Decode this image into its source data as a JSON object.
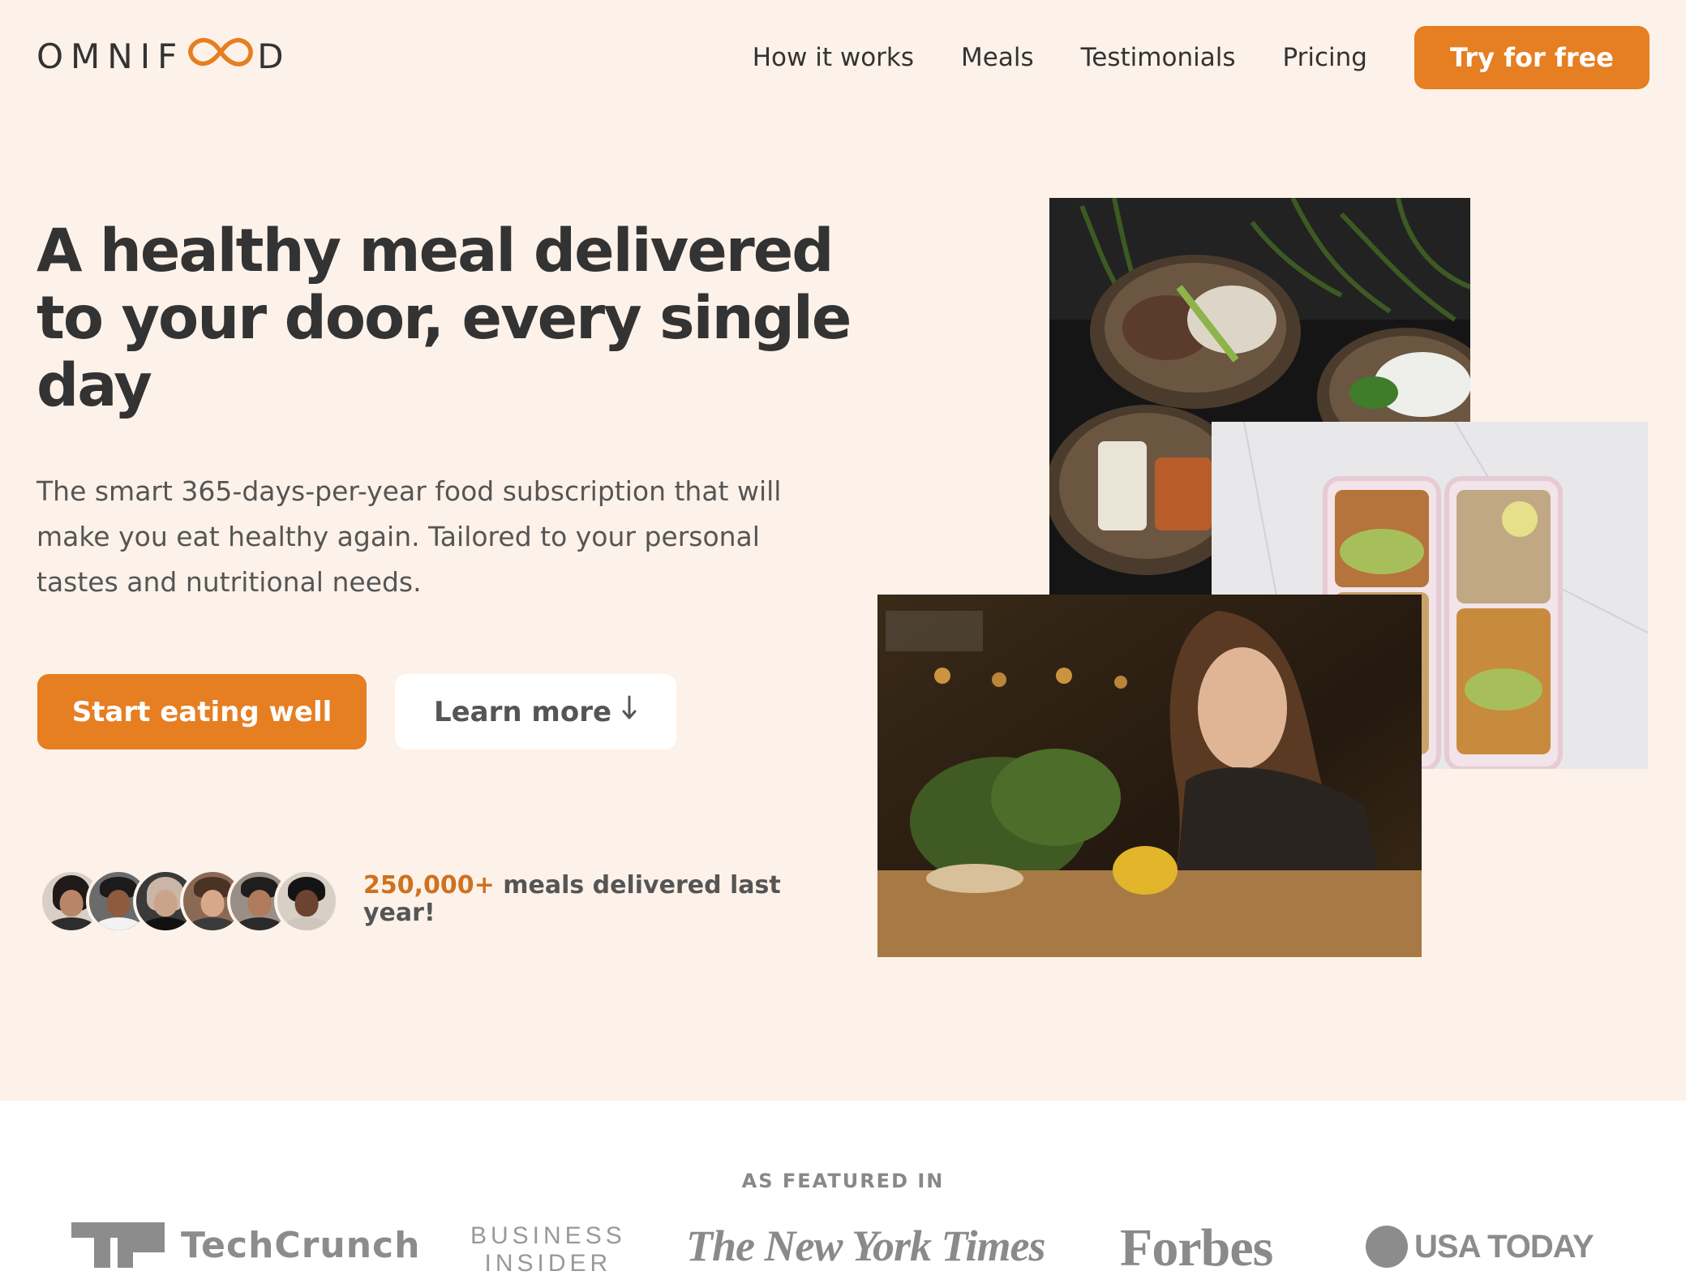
{
  "header": {
    "logo": {
      "prefix": "OMNIF",
      "suffix": "D",
      "icon": "infinity-icon",
      "accent": "#e67e22"
    },
    "nav": [
      {
        "label": "How it works"
      },
      {
        "label": "Meals"
      },
      {
        "label": "Testimonials"
      },
      {
        "label": "Pricing"
      }
    ],
    "cta_label": "Try for free"
  },
  "hero": {
    "title": "A healthy meal delivered to your door, every single day",
    "description": "The smart 365-days-per-year food subscription that will make you eat healthy again. Tailored to your personal tastes and nutritional needs.",
    "primary_button": "Start eating well",
    "secondary_button": "Learn more",
    "secondary_icon": "arrow-down-icon",
    "delivered": {
      "count": "250,000+",
      "text": "meals delivered last year!"
    },
    "photos": [
      "food-bowls-photo",
      "meal-prep-boxes-photo",
      "woman-eating-photo"
    ]
  },
  "featured": {
    "heading": "AS FEATURED IN",
    "logos": {
      "techcrunch": "TechCrunch",
      "business_insider_line1": "BUSINESS",
      "business_insider_line2": "INSIDER",
      "nyt": "The New York Times",
      "forbes": "Forbes",
      "usatoday": "USA TODAY"
    }
  },
  "colors": {
    "primary": "#e67e22",
    "hero_background": "#fdf2e9",
    "text": "#333333"
  }
}
